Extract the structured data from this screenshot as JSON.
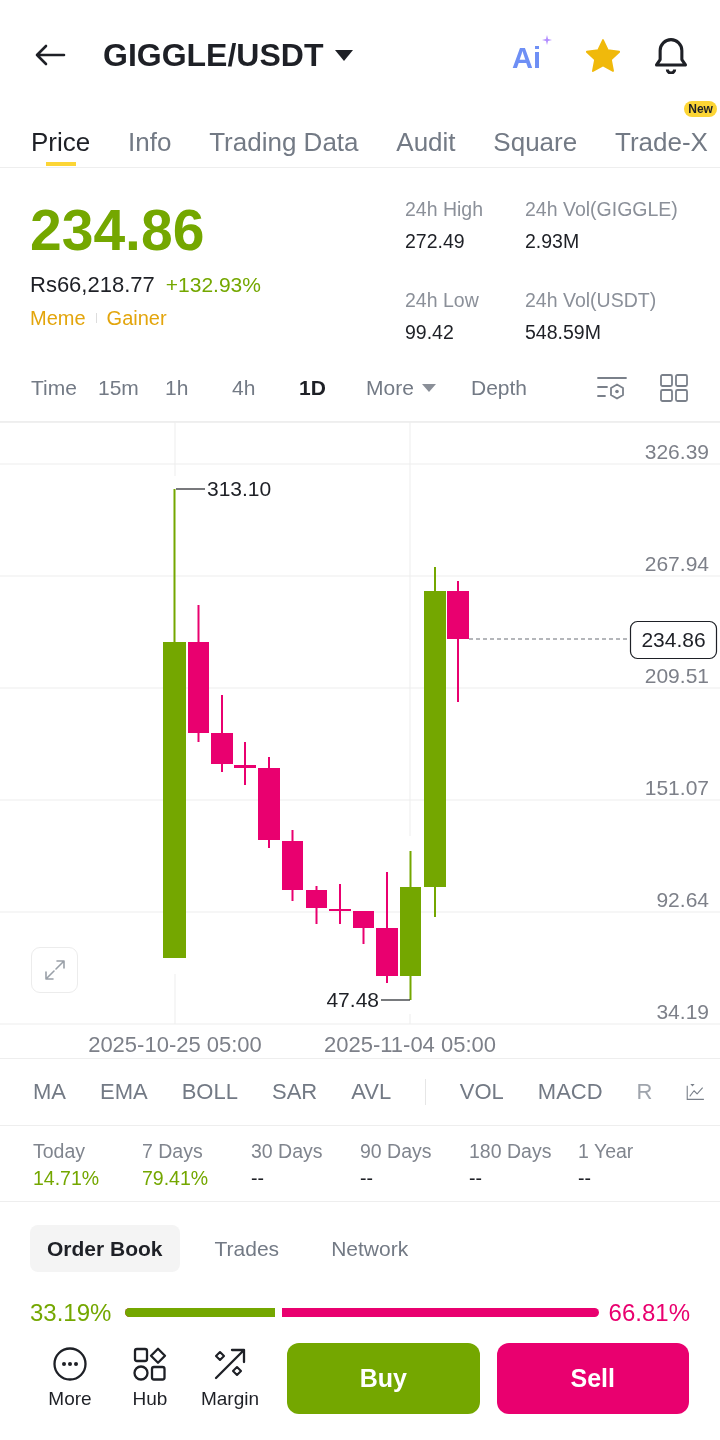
{
  "header": {
    "title": "GIGGLE/USDT",
    "ai_label": "Ai",
    "favorite": true
  },
  "tabs": [
    {
      "label": "Price",
      "selected": true
    },
    {
      "label": "Info",
      "selected": false
    },
    {
      "label": "Trading Data",
      "selected": false
    },
    {
      "label": "Audit",
      "selected": false
    },
    {
      "label": "Square",
      "selected": false
    },
    {
      "label": "Trade-X",
      "selected": false,
      "badge": "New"
    }
  ],
  "quote": {
    "last_price": "234.86",
    "fiat_price": "Rs66,218.77",
    "change": "+132.93%",
    "tags": [
      "Meme",
      "Gainer"
    ]
  },
  "stats": [
    {
      "label": "24h High",
      "value": "272.49"
    },
    {
      "label": "24h Vol(GIGGLE)",
      "value": "2.93M"
    },
    {
      "label": "24h Low",
      "value": "99.42"
    },
    {
      "label": "24h Vol(USDT)",
      "value": "548.59M"
    }
  ],
  "intervals": [
    {
      "label": "Time",
      "selected": false,
      "kind": "option"
    },
    {
      "label": "15m",
      "selected": false,
      "kind": "option"
    },
    {
      "label": "1h",
      "selected": false,
      "kind": "option"
    },
    {
      "label": "4h",
      "selected": false,
      "kind": "option"
    },
    {
      "label": "1D",
      "selected": true,
      "kind": "option"
    },
    {
      "label": "More",
      "selected": false,
      "kind": "dropdown"
    },
    {
      "label": "Depth",
      "selected": false,
      "kind": "option"
    }
  ],
  "chart": {
    "y_labels": [
      "326.39",
      "267.94",
      "209.51",
      "151.07",
      "92.64",
      "34.19"
    ],
    "x_labels": [
      "2025-10-25 05:00",
      "2025-11-04 05:00"
    ],
    "high_label": "313.10",
    "low_label": "47.48",
    "last_price_label": "234.86"
  },
  "indicators": {
    "main": [
      "MA",
      "EMA",
      "BOLL",
      "SAR",
      "AVL"
    ],
    "sub": [
      "VOL",
      "MACD",
      "R"
    ]
  },
  "performance": [
    {
      "period": "Today",
      "value": "14.71%",
      "kind": "gain"
    },
    {
      "period": "7 Days",
      "value": "79.41%",
      "kind": "gain"
    },
    {
      "period": "30 Days",
      "value": "--",
      "kind": "none"
    },
    {
      "period": "90 Days",
      "value": "--",
      "kind": "none"
    },
    {
      "period": "180 Days",
      "value": "--",
      "kind": "none"
    },
    {
      "period": "1 Year",
      "value": "--",
      "kind": "none"
    }
  ],
  "book_tabs": [
    {
      "label": "Order Book",
      "selected": true
    },
    {
      "label": "Trades",
      "selected": false
    },
    {
      "label": "Network",
      "selected": false
    }
  ],
  "ratio": {
    "buy": "33.19%",
    "sell": "66.81%",
    "level": 0.3319
  },
  "actions": [
    {
      "label": "More",
      "kind": "more"
    },
    {
      "label": "Hub",
      "kind": "hub"
    },
    {
      "label": "Margin",
      "kind": "margin"
    }
  ],
  "buy_label": "Buy",
  "sell_label": "Sell"
}
